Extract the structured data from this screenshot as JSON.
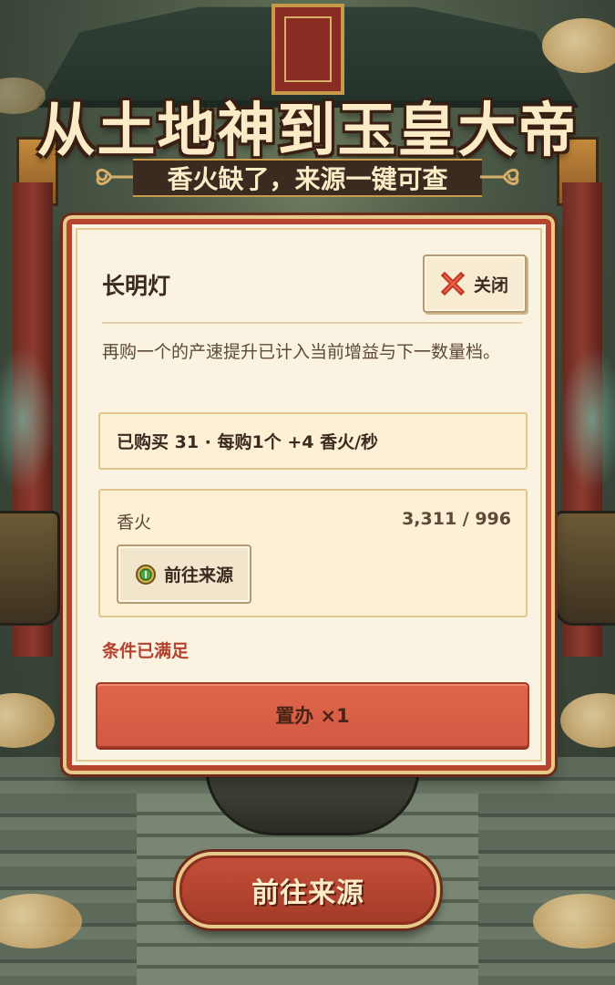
{
  "game": {
    "title": "从土地神到玉皇大帝",
    "subtitle": "香火缺了，来源一键可查"
  },
  "dialog": {
    "item_name": "长明灯",
    "close_label": "关闭",
    "description": "再购一个的产速提升已计入当前增益与下一数量档。",
    "purchase_info": "已购买 31 · 每购1个 +4 香火/秒",
    "requirement": {
      "resource_name": "香火",
      "amount": "3,311 / 996",
      "goto_label": "前往来源"
    },
    "status_text": "条件已满足",
    "buy_label": "置办 ×1"
  },
  "footer": {
    "goto_source_label": "前往来源"
  },
  "colors": {
    "panel_bg": "#fbf3e1",
    "panel_border": "#b5452f",
    "accent_red": "#d25a42",
    "status_red": "#b4402e",
    "gold": "#e7c98a"
  },
  "icons": {
    "close": "red-x-icon",
    "source": "green-coin-icon",
    "ornament": "gold-scroll-ornament"
  }
}
